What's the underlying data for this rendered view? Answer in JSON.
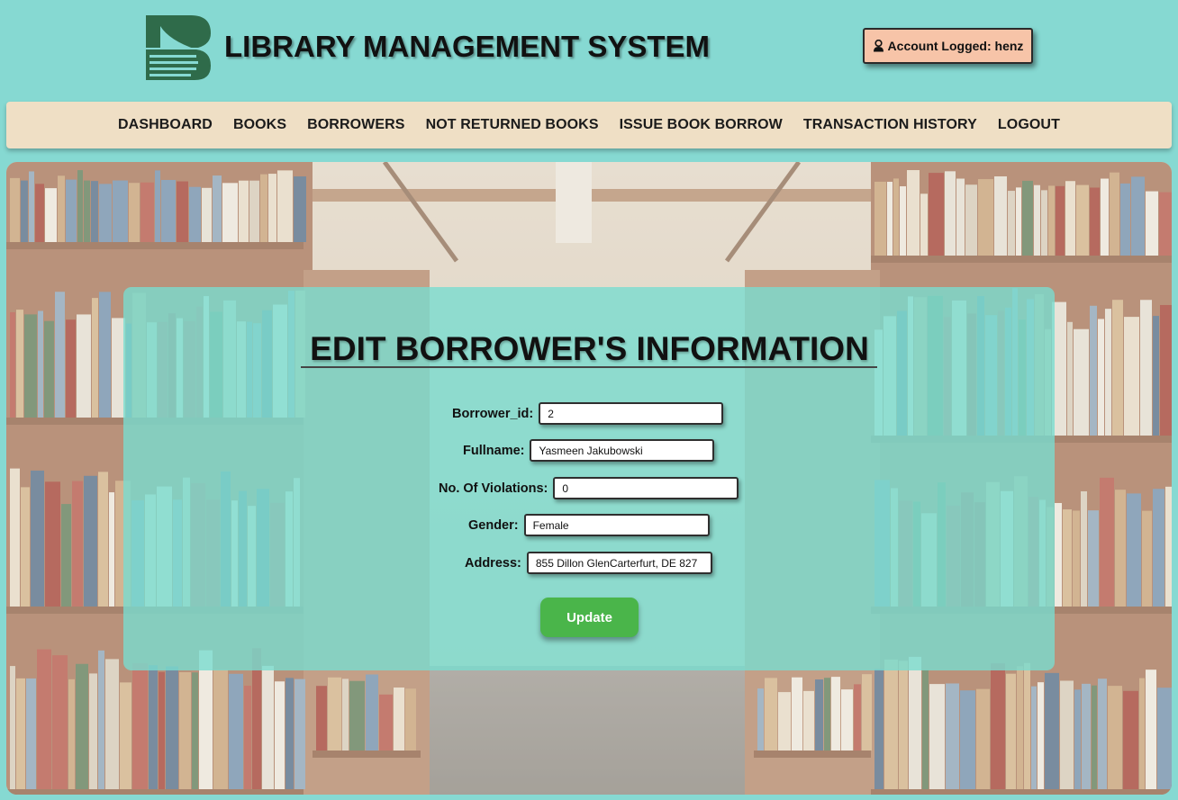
{
  "header": {
    "app_title": "LIBRARY MANAGEMENT SYSTEM",
    "account_text": "Account Logged: henz",
    "logo_icon": "book-logo-icon",
    "account_icon": "user-icon"
  },
  "nav": {
    "items": [
      {
        "label": "DASHBOARD"
      },
      {
        "label": "BOOKS"
      },
      {
        "label": "BORROWERS"
      },
      {
        "label": "NOT RETURNED BOOKS"
      },
      {
        "label": "ISSUE BOOK BORROW"
      },
      {
        "label": "TRANSACTION HISTORY"
      },
      {
        "label": "LOGOUT"
      }
    ]
  },
  "form": {
    "title": "EDIT BORROWER'S INFORMATION",
    "fields": {
      "borrower_id": {
        "label": "Borrower_id:",
        "value": "2"
      },
      "fullname": {
        "label": "Fullname:",
        "value": "Yasmeen Jakubowski"
      },
      "violations": {
        "label": "No. Of Violations:",
        "value": "0"
      },
      "gender": {
        "label": "Gender:",
        "value": "Female"
      },
      "address": {
        "label": "Address:",
        "value": "855 Dillon GlenCarterfurt, DE 827"
      }
    },
    "submit_label": "Update"
  },
  "colors": {
    "page_background": "#86d9d2",
    "nav_background": "#efdfc5",
    "account_badge": "#f7c4a8",
    "panel": "#79dcd0",
    "update_button": "#4ab54a",
    "logo": "#2f6b4a"
  }
}
